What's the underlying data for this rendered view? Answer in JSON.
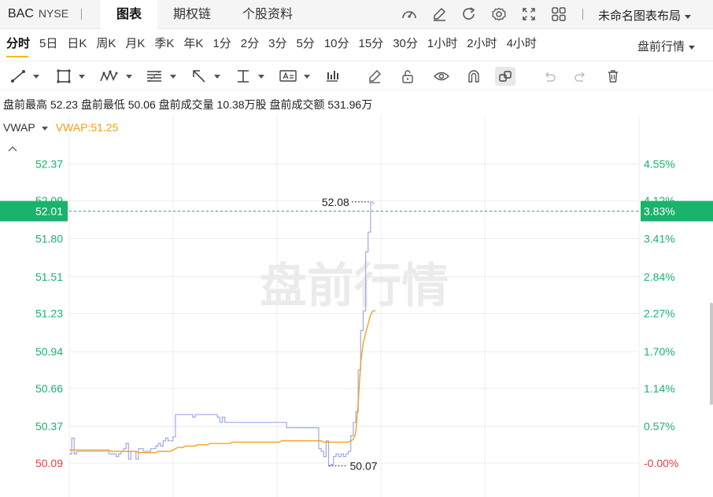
{
  "header": {
    "symbol": "BAC",
    "exchange": "NYSE",
    "tabs": [
      "图表",
      "期权链",
      "个股资料"
    ],
    "active_tab": 0,
    "icons": [
      "gauge-icon",
      "pen-icon",
      "refresh-icon",
      "gear-icon",
      "fullscreen-icon",
      "grid-icon"
    ],
    "layout_label": "未命名图表布局"
  },
  "periods": {
    "items": [
      "分时",
      "5日",
      "日K",
      "周K",
      "月K",
      "季K",
      "年K",
      "1分",
      "2分",
      "3分",
      "5分",
      "10分",
      "15分",
      "30分",
      "1小时",
      "2小时",
      "4小时"
    ],
    "active": 0,
    "session_label": "盘前行情"
  },
  "toolbar": {
    "tools": [
      "trendline-icon",
      "rectangle-icon",
      "pattern-icon",
      "fibonacci-icon",
      "arrow-icon",
      "measure-icon",
      "text-icon",
      "indicator-icon",
      "edit-icon",
      "unlock-icon",
      "eye-icon",
      "magnet-icon",
      "link-icon",
      "undo-icon",
      "redo-icon",
      "trash-icon"
    ]
  },
  "stats": {
    "high_label": "盘前最高",
    "high": "52.23",
    "low_label": "盘前最低",
    "low": "50.06",
    "volume_label": "盘前成交量",
    "volume": "10.38万股",
    "turnover_label": "盘前成交额",
    "turnover": "531.96万"
  },
  "indicator": {
    "name": "VWAP",
    "value_label": "VWAP:51.25"
  },
  "watermark": "盘前行情",
  "colors": {
    "up": "#19b36b",
    "down": "#e5403b",
    "price_line": "#9fa8ea",
    "vwap_line": "#f39c12",
    "tab_active_underline": "#f5b800"
  },
  "chart_data": {
    "type": "line",
    "y_ticks_price": [
      "52.37",
      "52.09",
      "51.80",
      "51.51",
      "51.23",
      "50.94",
      "50.66",
      "50.37",
      "50.09"
    ],
    "y_ticks_pct": [
      "4.55%",
      "4.12%",
      "3.41%",
      "2.84%",
      "2.27%",
      "1.70%",
      "1.14%",
      "0.57%",
      "-0.00%"
    ],
    "ylim": [
      49.85,
      52.6
    ],
    "base_price": 50.09,
    "current_price": "52.01",
    "current_pct": "3.83%",
    "max_marker": {
      "label": "52.08",
      "value": 52.08,
      "index": 122
    },
    "min_marker": {
      "label": "50.07",
      "value": 50.07,
      "index": 105
    },
    "series": [
      {
        "name": "price",
        "values": [
          50.16,
          50.28,
          50.16,
          50.18,
          50.18,
          50.18,
          50.18,
          50.18,
          50.18,
          50.18,
          50.18,
          50.18,
          50.18,
          50.18,
          50.18,
          50.18,
          50.16,
          50.16,
          50.16,
          50.14,
          50.16,
          50.18,
          50.2,
          50.24,
          50.12,
          50.18,
          50.18,
          50.12,
          50.2,
          50.2,
          50.18,
          50.18,
          50.18,
          50.2,
          50.2,
          50.22,
          50.24,
          50.22,
          50.26,
          50.28,
          50.26,
          50.26,
          50.29,
          50.46,
          50.46,
          50.46,
          50.46,
          50.46,
          50.46,
          50.46,
          50.44,
          50.46,
          50.46,
          50.46,
          50.46,
          50.46,
          50.46,
          50.46,
          50.46,
          50.46,
          50.44,
          50.4,
          50.44,
          50.4,
          50.4,
          50.4,
          50.4,
          50.4,
          50.4,
          50.4,
          50.4,
          50.4,
          50.4,
          50.4,
          50.4,
          50.4,
          50.4,
          50.4,
          50.4,
          50.4,
          50.4,
          50.4,
          50.4,
          50.4,
          50.4,
          50.4,
          50.4,
          50.4,
          50.36,
          50.36,
          50.36,
          50.36,
          50.36,
          50.36,
          50.36,
          50.36,
          50.36,
          50.36,
          50.36,
          50.36,
          50.36,
          50.2,
          50.18,
          50.14,
          50.26,
          50.07,
          50.08,
          50.14,
          50.16,
          50.14,
          50.16,
          50.14,
          50.16,
          50.18,
          50.3,
          50.4,
          50.48,
          50.8,
          51.1,
          51.25,
          51.7,
          51.85,
          52.08,
          52.06
        ],
        "color": "#9fa8ea"
      },
      {
        "name": "VWAP",
        "values": [
          50.19,
          50.19,
          50.19,
          50.19,
          50.19,
          50.19,
          50.19,
          50.19,
          50.19,
          50.19,
          50.19,
          50.19,
          50.19,
          50.19,
          50.19,
          50.19,
          50.19,
          50.18,
          50.18,
          50.18,
          50.18,
          50.18,
          50.18,
          50.18,
          50.18,
          50.18,
          50.18,
          50.18,
          50.17,
          50.17,
          50.17,
          50.17,
          50.17,
          50.17,
          50.17,
          50.17,
          50.18,
          50.18,
          50.18,
          50.18,
          50.18,
          50.18,
          50.19,
          50.2,
          50.21,
          50.21,
          50.21,
          50.22,
          50.22,
          50.22,
          50.22,
          50.22,
          50.23,
          50.23,
          50.23,
          50.23,
          50.23,
          50.24,
          50.24,
          50.24,
          50.24,
          50.24,
          50.24,
          50.24,
          50.24,
          50.24,
          50.25,
          50.25,
          50.25,
          50.25,
          50.25,
          50.25,
          50.25,
          50.25,
          50.25,
          50.25,
          50.25,
          50.25,
          50.25,
          50.25,
          50.25,
          50.25,
          50.25,
          50.25,
          50.25,
          50.25,
          50.26,
          50.26,
          50.26,
          50.26,
          50.26,
          50.26,
          50.26,
          50.26,
          50.26,
          50.26,
          50.26,
          50.26,
          50.26,
          50.26,
          50.26,
          50.26,
          50.26,
          50.25,
          50.25,
          50.25,
          50.25,
          50.25,
          50.25,
          50.25,
          50.25,
          50.25,
          50.25,
          50.25,
          50.26,
          50.27,
          50.32,
          50.55,
          50.85,
          51.0,
          51.08,
          51.15,
          51.22,
          51.25,
          51.25
        ]
      }
    ],
    "grid": true
  }
}
